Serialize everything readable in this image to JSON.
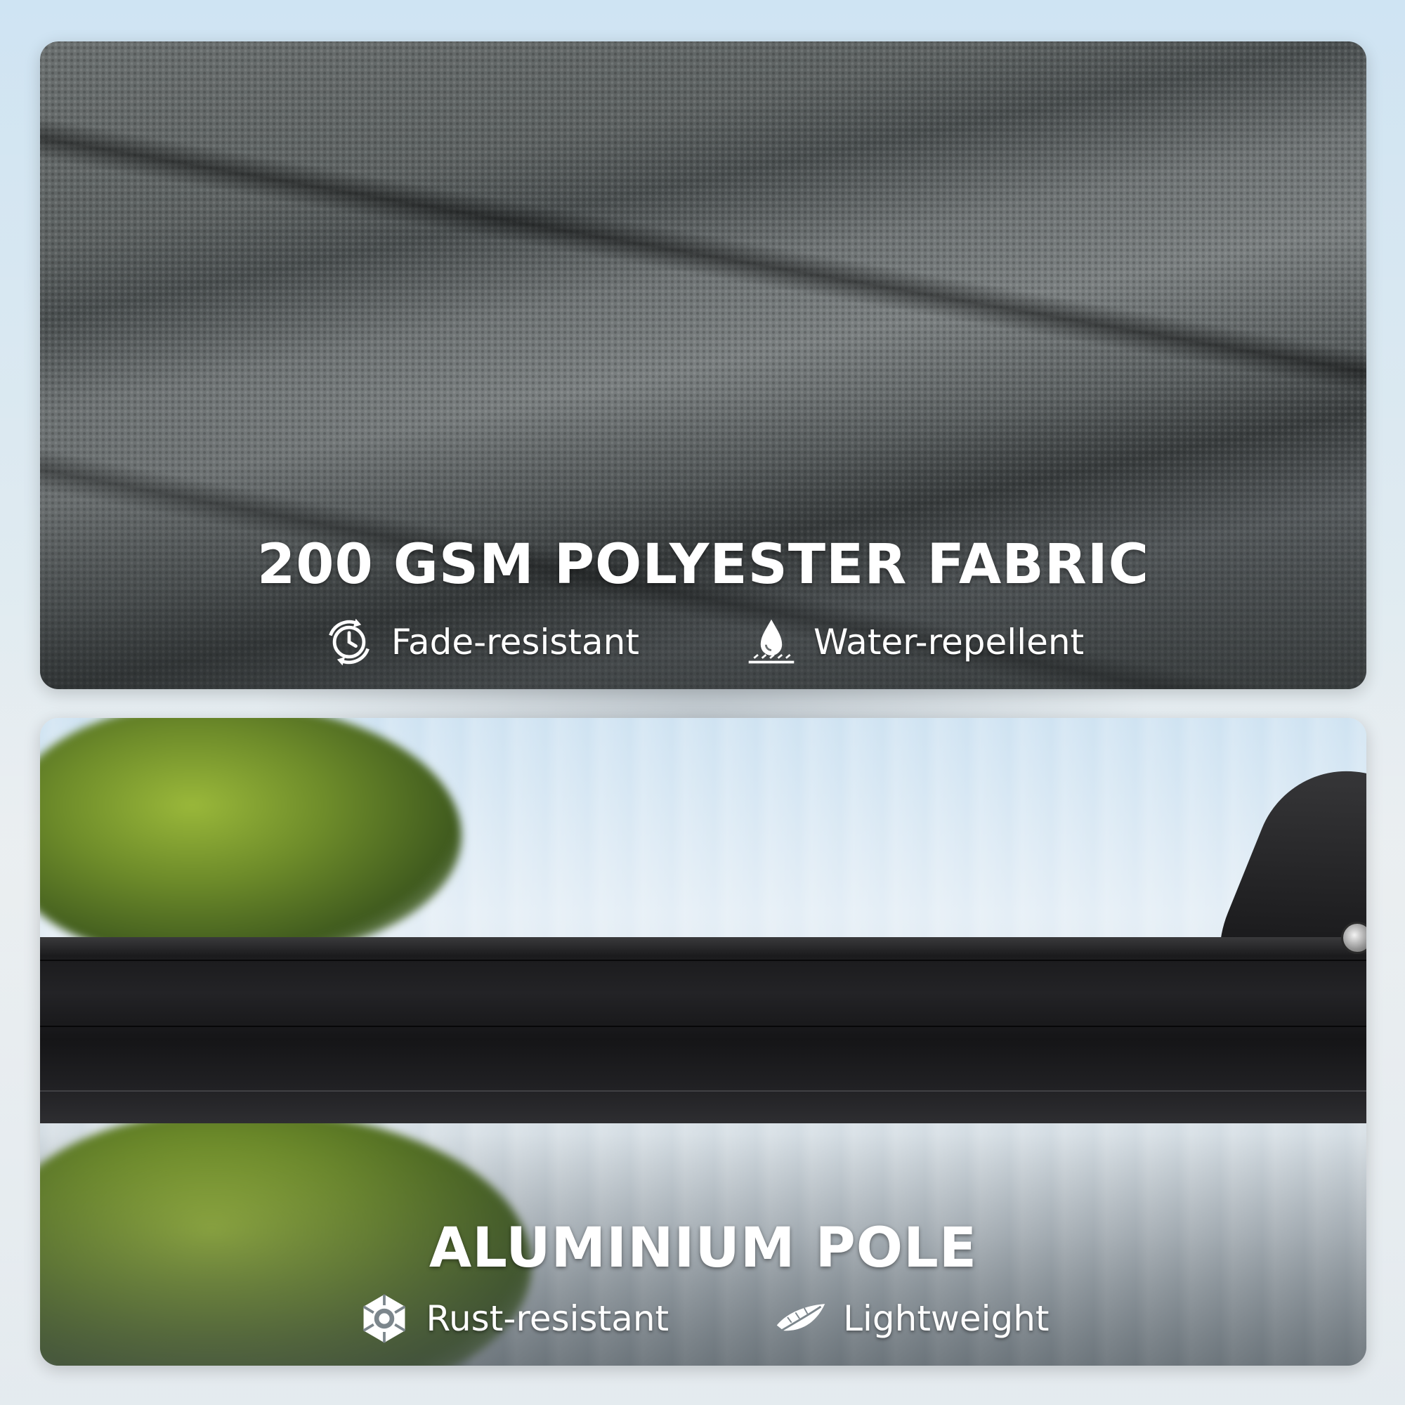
{
  "panels": [
    {
      "heading": "200 GSM POLYESTER FABRIC",
      "features": [
        {
          "label": "Fade-resistant",
          "icon": "fade-resistant-icon"
        },
        {
          "label": "Water-repellent",
          "icon": "water-drop-icon"
        }
      ]
    },
    {
      "heading": "ALUMINIUM POLE",
      "features": [
        {
          "label": "Rust-resistant",
          "icon": "rust-resistant-icon"
        },
        {
          "label": "Lightweight",
          "icon": "feather-icon"
        }
      ]
    }
  ],
  "colors": {
    "text": "#ffffff",
    "fabric": "#5f6465",
    "pole": "#1c1c1e"
  }
}
